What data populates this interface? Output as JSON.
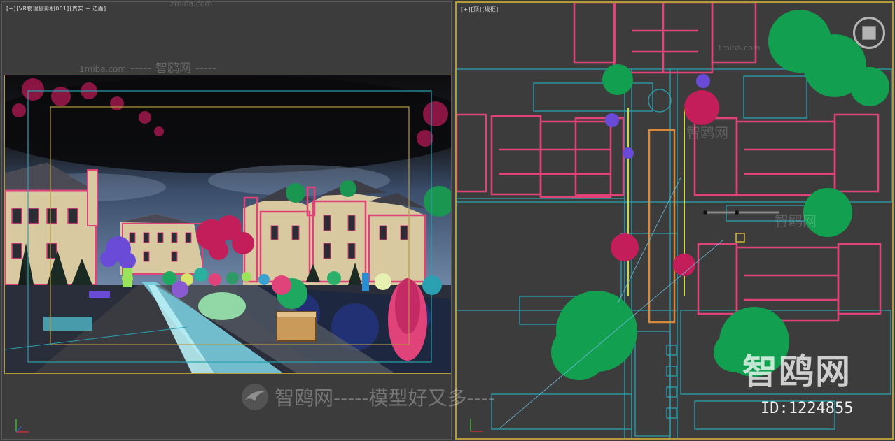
{
  "left_viewport": {
    "label_parts": [
      "[+]",
      "[VR物理摄影机001]",
      "[真实 + 边面]"
    ],
    "site_watermark": "1miba.com",
    "top_watermark": "----- 智鸥网 -----",
    "top_right_faint": "zmiba.com"
  },
  "right_viewport": {
    "label_parts": [
      "[+]",
      "[顶]",
      "[线框]"
    ],
    "faint_site": "1miba.com",
    "faint_brand_1": "智鸥网",
    "faint_brand_2": "智鸥网"
  },
  "watermark": {
    "bottom_text": "智鸥网-----模型好又多----",
    "brand_big": "智鸥网",
    "id_label": "ID:1224855"
  },
  "colors": {
    "background": "#3c3c3c",
    "active_border": "#b59a3b",
    "building_pink": "#e0427a",
    "tree_green": "#12a050",
    "cyan_lines": "#2aa0b0",
    "shrub_purple": "#6a4bd8"
  },
  "icons": {
    "nav_cube": "viewcube-icon",
    "axis": "axis-gizmo-icon",
    "logo": "bird-logo-icon"
  }
}
